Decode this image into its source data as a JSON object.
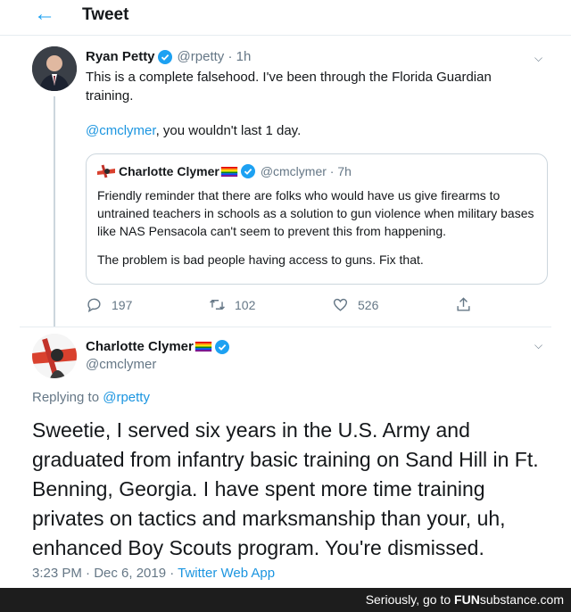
{
  "header": {
    "title": "Tweet",
    "back_icon": "arrow-left-icon"
  },
  "parent_tweet": {
    "name": "Ryan Petty",
    "handle_time": "@rpetty · 1h",
    "text_line1": "This is a complete falsehood. I've been through the Florida Guardian",
    "text_line2": "training.",
    "mention": "@cmclymer",
    "mention_rest": ", you wouldn't last 1 day.",
    "quote": {
      "name": "Charlotte Clymer",
      "handle_time": "@cmclymer · 7h",
      "text_p1": "Friendly reminder that there are folks who would have us give firearms to untrained teachers in schools as a solution to gun violence when military bases like NAS Pensacola can't seem to prevent this from happening.",
      "text_p2": "The problem is bad people having access to guns. Fix that."
    },
    "actions": {
      "reply_count": "197",
      "retweet_count": "102",
      "like_count": "526"
    }
  },
  "main_tweet": {
    "name": "Charlotte Clymer",
    "handle": "@cmclymer",
    "replying_prefix": "Replying to ",
    "replying_to": "@rpetty",
    "text": "Sweetie, I served six years in the U.S. Army and graduated from infantry basic training on Sand Hill in Ft. Benning, Georgia. I have spent more time training privates on tactics and marksmanship than your, uh, enhanced Boy Scouts program. You're dismissed.",
    "timestamp": "3:23 PM · Dec 6, 2019 · ",
    "app": "Twitter Web App"
  },
  "footer": {
    "prefix": "Seriously, go to ",
    "brand_fun": "FUN",
    "brand_rest": "substance",
    "brand_tld": ".com"
  },
  "colors": {
    "accent": "#1da1f2",
    "link": "#1b95e0",
    "muted": "#657786",
    "footer_bg": "#1d1d1d"
  }
}
